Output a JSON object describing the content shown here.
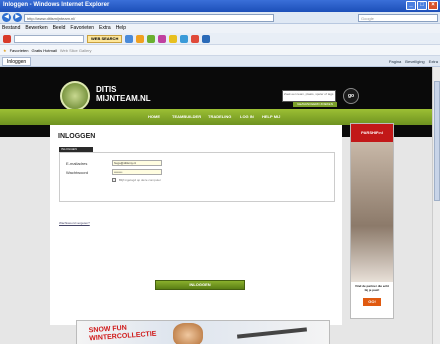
{
  "window": {
    "title": "Inloggen - Windows Internet Explorer"
  },
  "address": {
    "url": "http://www.ditismijnteam.nl/",
    "search_placeholder": "Google"
  },
  "menu": [
    "Bestand",
    "Bewerken",
    "Beeld",
    "Favorieten",
    "Extra",
    "Help"
  ],
  "toolbar": {
    "websearch_label": "WEB SEARCH"
  },
  "favorites": {
    "label": "Favorieten",
    "item1": "Gratis Hotmail",
    "item2": "Web Slice Gallery"
  },
  "tab": {
    "label": "Inloggen",
    "tools": [
      "Pagina",
      "Beveiliging",
      "Extra"
    ]
  },
  "site": {
    "logo_line1": "DITIS",
    "logo_line2": "MIJNTEAM.NL",
    "nav": [
      "HOME",
      "TEAMBUILDER",
      "TRADELING",
      "LOG IN",
      "HELP MIJ"
    ],
    "search_placeholder": "Zoek een team, plaats, speler of tags",
    "search_button": "GEAVANCEERD ZOEKEN",
    "go_label": "go"
  },
  "login": {
    "title": "INLOGGEN",
    "panel_tab": "INLOGGEN",
    "email_label": "E-mailadres",
    "email_value": "hugo@ditismy.nl",
    "password_label": "Wachtwoord",
    "password_value": "••••••••",
    "remember_label": "Blijf ingelogd op deze computer",
    "forgot_link": "Wachtwoord vergeten?",
    "submit": "INLOGGEN"
  },
  "ad": {
    "brand": "PARSHIP.nl",
    "text": "Vind de partner die echt bij je past!",
    "button": "GO!"
  },
  "banner": {
    "text_line1": "SNOW FUN",
    "text_line2": "WINTERCOLLECTIE"
  }
}
